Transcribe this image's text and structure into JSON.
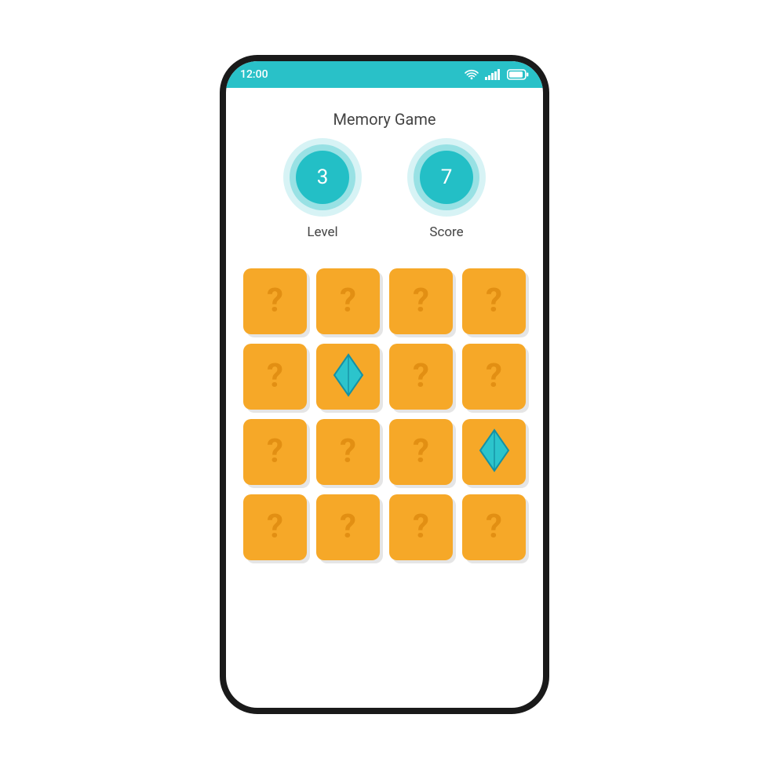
{
  "status": {
    "time": "12:00",
    "icons": {
      "wifi": "wifi-icon",
      "signal": "signal-icon",
      "battery": "battery-icon"
    }
  },
  "title": "Memory Game",
  "stats": {
    "level": {
      "value": "3",
      "label": "Level"
    },
    "score": {
      "value": "7",
      "label": "Score"
    }
  },
  "grid": {
    "columns": 4,
    "cards": [
      {
        "state": "hidden"
      },
      {
        "state": "hidden"
      },
      {
        "state": "hidden"
      },
      {
        "state": "hidden"
      },
      {
        "state": "hidden"
      },
      {
        "state": "revealed",
        "shape": "diamond"
      },
      {
        "state": "hidden"
      },
      {
        "state": "hidden"
      },
      {
        "state": "hidden"
      },
      {
        "state": "hidden"
      },
      {
        "state": "hidden"
      },
      {
        "state": "revealed",
        "shape": "diamond"
      },
      {
        "state": "hidden"
      },
      {
        "state": "hidden"
      },
      {
        "state": "hidden"
      },
      {
        "state": "hidden"
      }
    ]
  },
  "glyphs": {
    "hidden_marker": "?"
  },
  "colors": {
    "accent": "#29c1c8",
    "card": "#f6a828",
    "card_marker": "#e28f13",
    "diamond_fill": "#2cc4cc",
    "diamond_stroke": "#1591a4"
  }
}
